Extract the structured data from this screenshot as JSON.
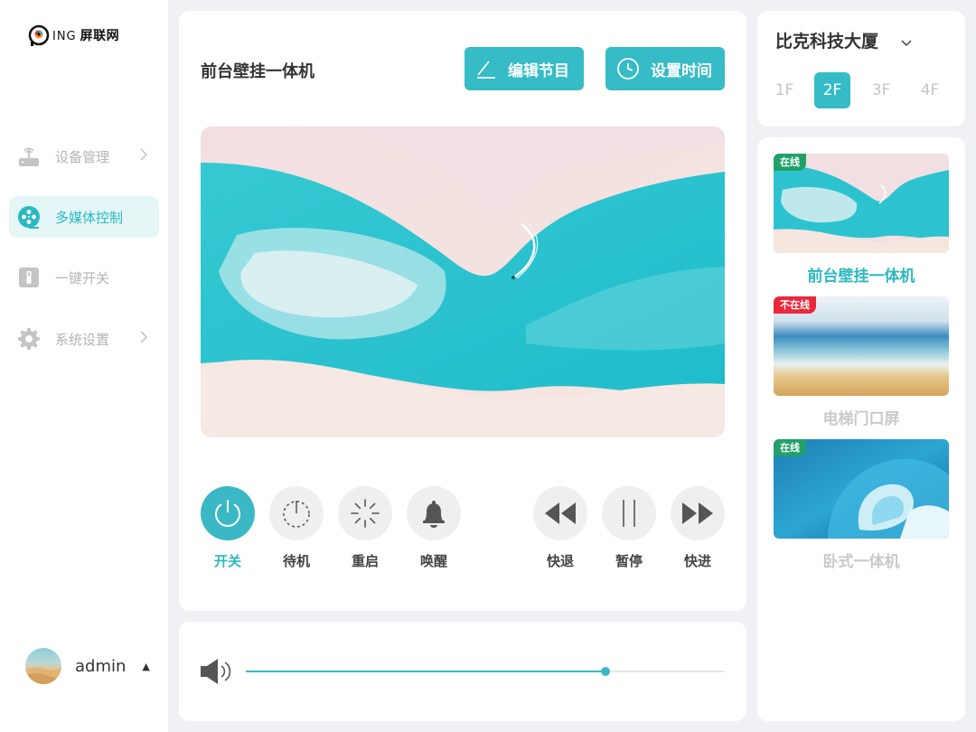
{
  "brand": {
    "mark_text": "ING",
    "name": "屏联网"
  },
  "sidebar": {
    "items": [
      {
        "label": "设备管理",
        "icon": "router-icon",
        "has_chevron": true
      },
      {
        "label": "多媒体控制",
        "icon": "film-reel-icon",
        "active": true
      },
      {
        "label": "一键开关",
        "icon": "switch-icon"
      },
      {
        "label": "系统设置",
        "icon": "gear-icon",
        "has_chevron": true
      }
    ],
    "user": {
      "name": "admin",
      "caret": "▲"
    }
  },
  "main": {
    "device_title": "前台壁挂一体机",
    "edit_button": "编辑节目",
    "time_button": "设置时间",
    "controls": [
      {
        "label": "开关",
        "icon": "power-icon",
        "active": true
      },
      {
        "label": "待机",
        "icon": "standby-icon"
      },
      {
        "label": "重启",
        "icon": "restart-icon"
      },
      {
        "label": "唤醒",
        "icon": "bell-icon"
      },
      {
        "label": "快退",
        "icon": "rewind-icon"
      },
      {
        "label": "暂停",
        "icon": "pause-icon"
      },
      {
        "label": "快进",
        "icon": "fast-forward-icon"
      }
    ],
    "volume": {
      "level_percent": 75
    }
  },
  "building": {
    "name": "比克科技大厦",
    "floors": [
      "1F",
      "2F",
      "3F",
      "4F"
    ],
    "selected_floor": "2F"
  },
  "devices": [
    {
      "name": "前台壁挂一体机",
      "status": "在线",
      "online": true,
      "active": true
    },
    {
      "name": "电梯门口屏",
      "status": "不在线",
      "online": false
    },
    {
      "name": "卧式一体机",
      "status": "在线",
      "online": true
    }
  ],
  "colors": {
    "accent": "#35bcc6",
    "online": "#22a06b",
    "offline": "#e9283a"
  }
}
